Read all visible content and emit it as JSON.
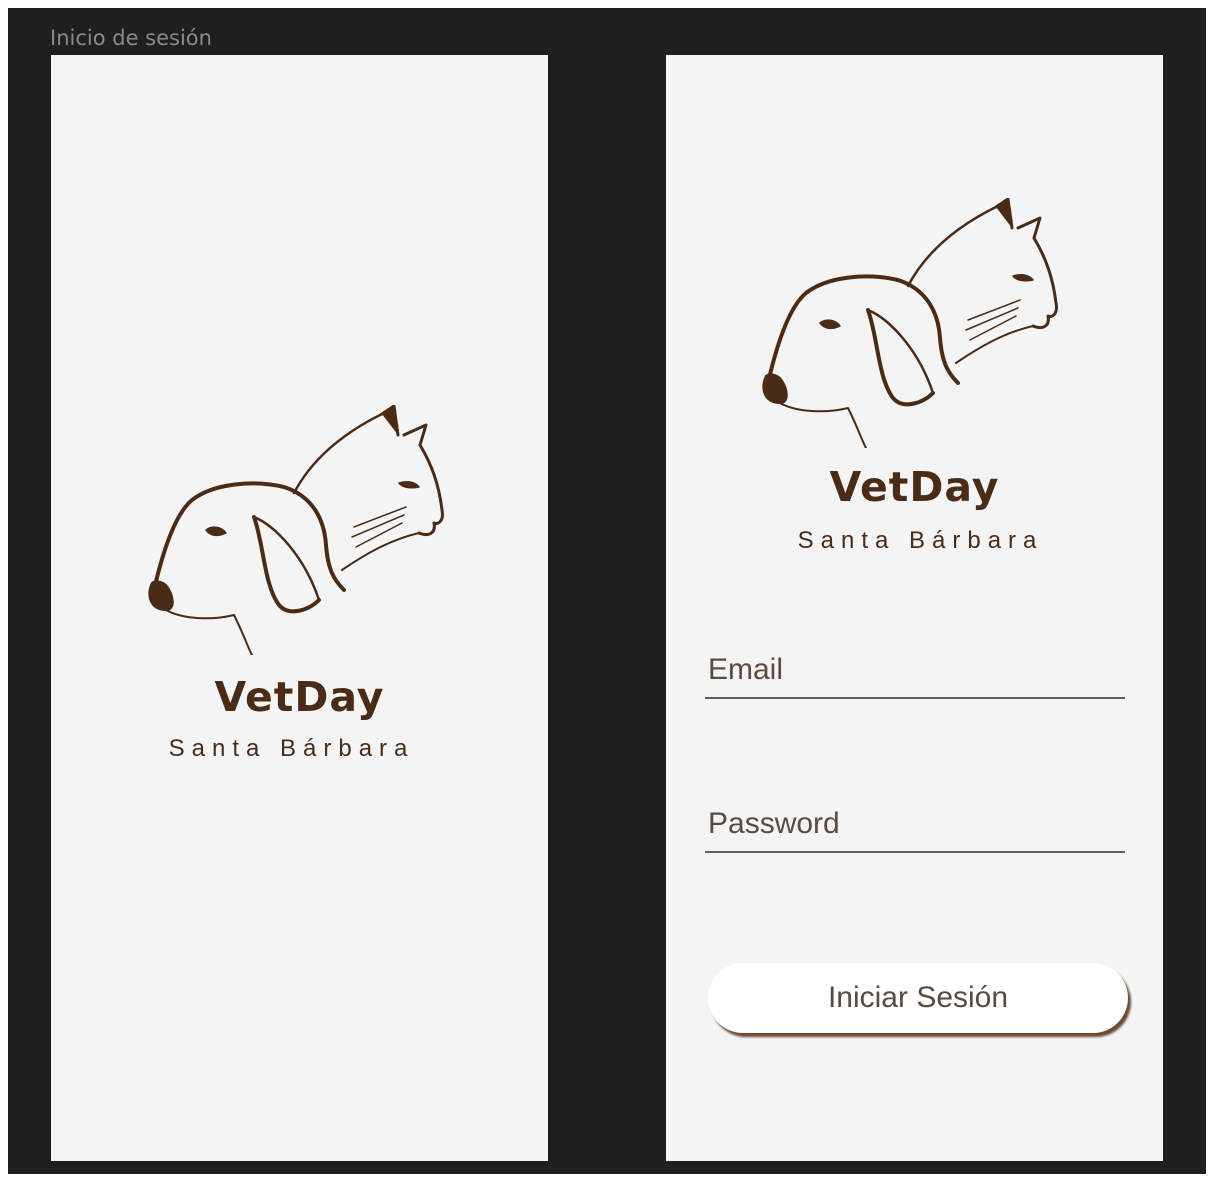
{
  "frame": {
    "label": "Inicio de sesión"
  },
  "brand": {
    "name": "VetDay",
    "subtitle": "Santa Bárbara",
    "logo_icon": "dog-and-cat-icon",
    "color": "#4a2b16"
  },
  "login": {
    "email_placeholder": "Email",
    "password_placeholder": "Password",
    "submit_label": "Iniciar Sesión"
  },
  "colors": {
    "canvas": "#1f1f1f",
    "screen": "#f4f4f4",
    "button": "#ffffff",
    "button_shadow": "#6b4a36"
  }
}
